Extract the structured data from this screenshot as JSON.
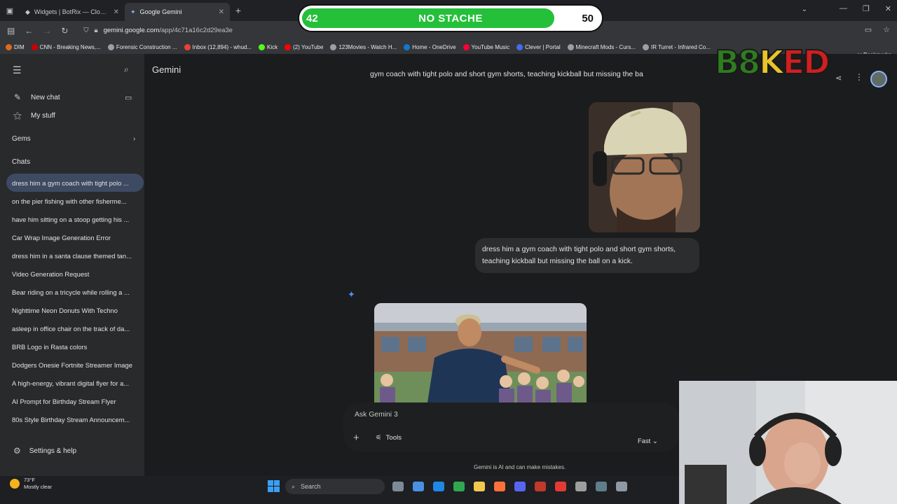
{
  "browser": {
    "tabs": [
      {
        "title": "Widgets | BotRix — Cloud Streaming",
        "active": false
      },
      {
        "title": "Google Gemini",
        "active": true
      }
    ],
    "address": {
      "host": "gemini.google.com",
      "path": "/app/4c71a16c2d29ea3e"
    },
    "bookmarks": [
      {
        "label": "DIM",
        "color": "#e06a1a"
      },
      {
        "label": "CNN - Breaking News,...",
        "color": "#cc0000"
      },
      {
        "label": "Forensic Construction ...",
        "color": "#9aa0a6"
      },
      {
        "label": "Inbox (12,894) - whud...",
        "color": "#ea4335"
      },
      {
        "label": "Kick",
        "color": "#53fc18"
      },
      {
        "label": "(2) YouTube",
        "color": "#ff0000"
      },
      {
        "label": "123Movies - Watch H...",
        "color": "#9aa0a6"
      },
      {
        "label": "Home - OneDrive",
        "color": "#0f78d4"
      },
      {
        "label": "YouTube Music",
        "color": "#ff0033"
      },
      {
        "label": "Clever | Portal",
        "color": "#436cf2"
      },
      {
        "label": "Minecraft Mods - Curs...",
        "color": "#9aa0a6"
      },
      {
        "label": "IR Turret - Infrared Co...",
        "color": "#9aa0a6"
      }
    ],
    "bookmarks_end": "er Bookmarks"
  },
  "sidebar": {
    "new_chat": "New chat",
    "my_stuff": "My stuff",
    "gems": "Gems",
    "chats_heading": "Chats",
    "chats": [
      "dress him a gym coach with tight polo ...",
      "on the pier fishing with other fisherme...",
      "have him sitting on a stoop getting his ...",
      "Car Wrap Image Generation Error",
      "dress him in a santa clause themed tan...",
      "Video Generation Request",
      "Bear riding on a tricycle while rolling a ...",
      "Nighttime Neon Donuts With Techno",
      "asleep in office chair on the track of da...",
      "BRB Logo in Rasta colors",
      "Dodgers Onesie Fortnite Streamer Image",
      "A high-energy, vibrant digital flyer for a...",
      "AI Prompt for Birthday Stream Flyer",
      "80s Style Birthday Stream Announcem..."
    ],
    "settings": "Settings & help"
  },
  "main": {
    "app_title": "Gemini",
    "previous_message": "gym coach with tight polo and short gym shorts, teaching kickball but missing the ba",
    "user_message": "dress him a gym coach with tight polo and short gym shorts, teaching kickball but missing the ball on a kick.",
    "input_placeholder": "Ask Gemini 3",
    "tools_label": "Tools",
    "mode_label": "Fast",
    "disclaimer": "Gemini is AI and can make mistakes."
  },
  "taskbar": {
    "temperature": "73°F",
    "weather": "Mostly clear",
    "search": "Search"
  },
  "overlay": {
    "left_count": "42",
    "center_label": "NO STACHE",
    "right_count": "50",
    "progress_fraction": 0.84,
    "logo_text": "B8KED"
  }
}
